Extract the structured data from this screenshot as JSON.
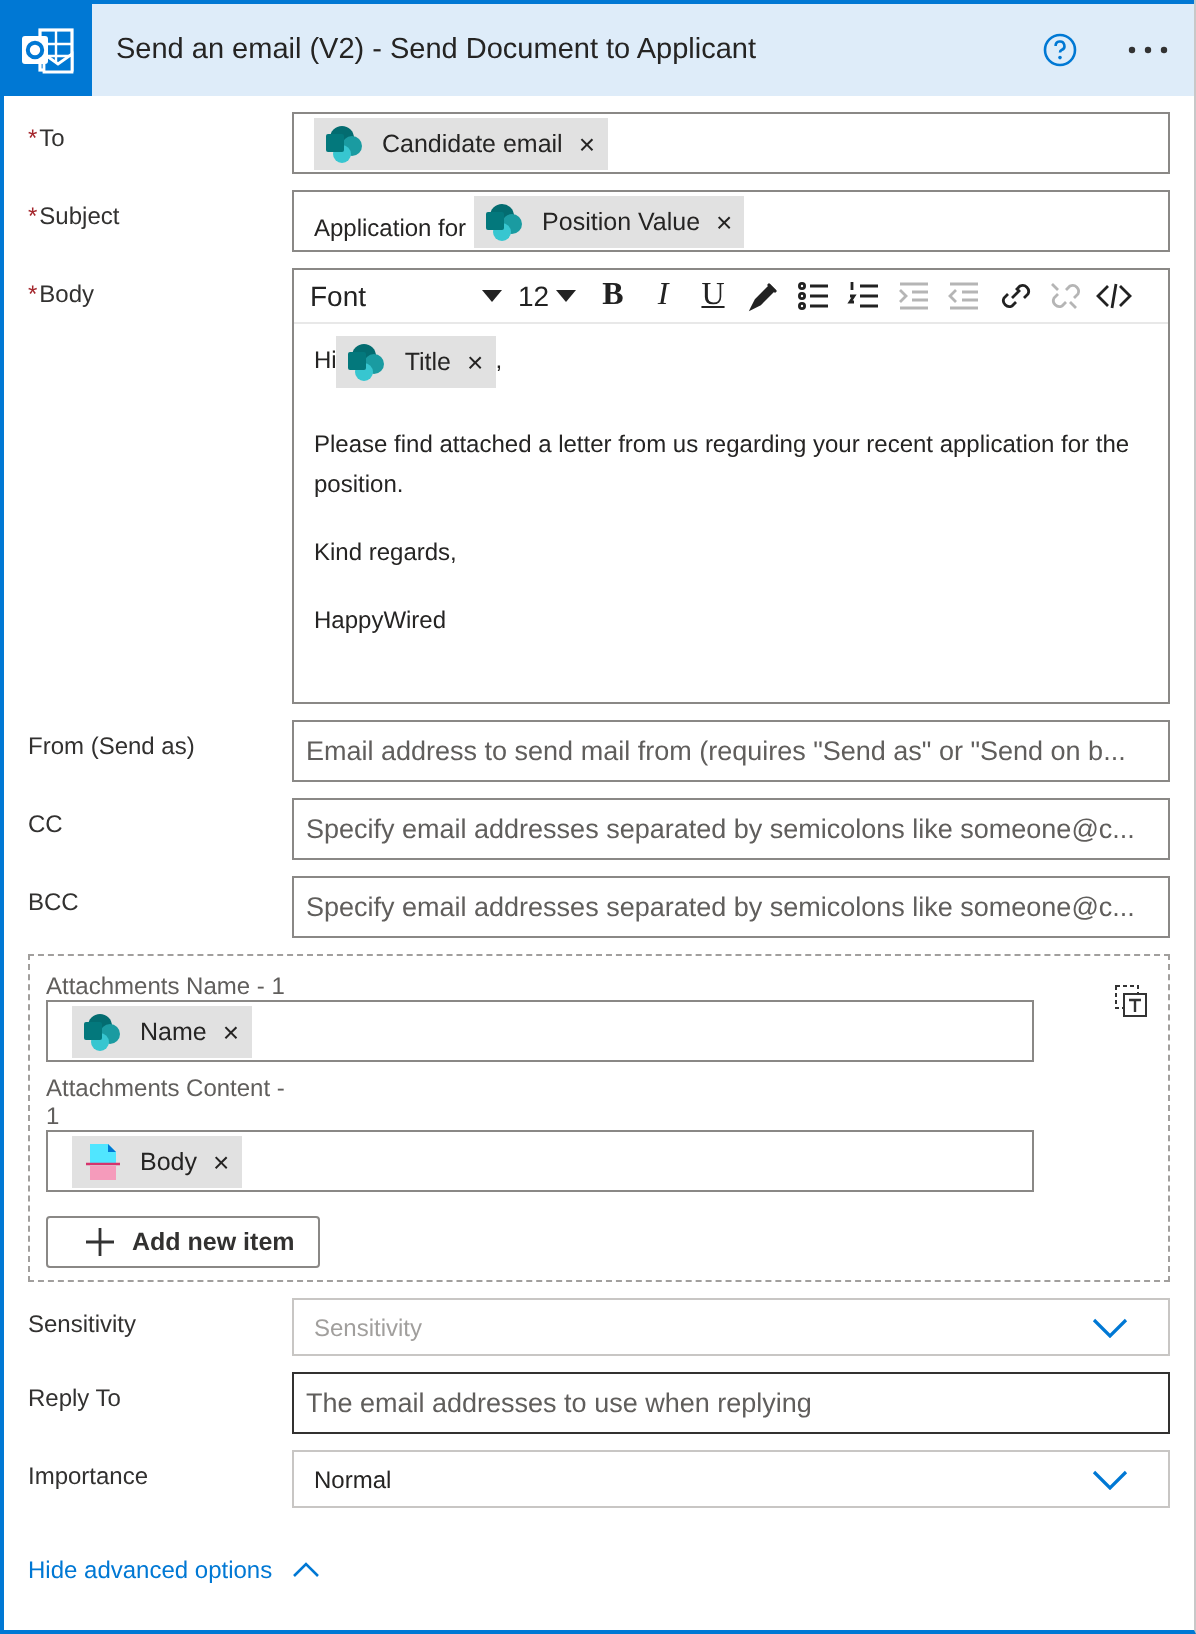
{
  "header": {
    "title": "Send an email (V2) - Send Document to Applicant"
  },
  "fields": [
    {
      "kind": "tokens",
      "label": "To",
      "mark": "*",
      "tokens": [
        {
          "text": "Candidate email",
          "kind": "sharepoint",
          "remove": "×"
        }
      ]
    },
    {
      "kind": "tokens",
      "label": "Subject",
      "mark": "*",
      "prefix": "Application for",
      "tokens": [
        {
          "text": "Position Value",
          "kind": "sharepoint",
          "remove": "×"
        }
      ]
    },
    {
      "kind": "editor",
      "label": "Body",
      "mark": "*",
      "font": "Font",
      "size": "12",
      "buttons": [
        {
          "kind": "bold",
          "label": "B",
          "disabled": false
        },
        {
          "kind": "italic",
          "label": "I",
          "disabled": false
        },
        {
          "kind": "underline",
          "label": "U",
          "disabled": false
        },
        {
          "kind": "color",
          "disabled": false
        },
        {
          "kind": "bullets",
          "disabled": false
        },
        {
          "kind": "numbers",
          "disabled": false
        },
        {
          "kind": "indent",
          "disabled": true
        },
        {
          "kind": "outdent",
          "disabled": true
        },
        {
          "kind": "link",
          "disabled": false
        },
        {
          "kind": "unlink",
          "disabled": true
        },
        {
          "kind": "code",
          "disabled": false
        }
      ],
      "paragraphs": [
        [
          {
            "kind": "text",
            "text": "Hi"
          },
          {
            "kind": "sharepoint",
            "text": "Title",
            "remove": "×"
          },
          {
            "kind": "text",
            "text": ","
          }
        ],
        [
          {
            "kind": "text",
            "text": "Please find attached a letter from us regarding your recent application for the position."
          }
        ],
        [
          {
            "kind": "text",
            "text": "Kind regards,"
          }
        ],
        [
          {
            "kind": "text",
            "text": "HappyWired"
          }
        ]
      ]
    },
    {
      "kind": "text",
      "label": "From (Send as)",
      "placeholder": "Email address to send mail from (requires \"Send as\" or \"Send on b...",
      "focused": false
    },
    {
      "kind": "text",
      "label": "CC",
      "placeholder": "Specify email addresses separated by semicolons like someone@c...",
      "focused": false
    },
    {
      "kind": "text",
      "label": "BCC",
      "placeholder": "Specify email addresses separated by semicolons like someone@c...",
      "focused": false
    },
    {
      "kind": "array",
      "items": [
        {
          "label": "Attachments Name - 1",
          "tokens": [
            {
              "text": "Name",
              "kind": "sharepoint",
              "remove": "×"
            }
          ]
        },
        {
          "label": "Attachments Content - 1",
          "tokens": [
            {
              "text": "Body",
              "kind": "file",
              "remove": "×"
            }
          ]
        }
      ],
      "add_label": "Add new item"
    },
    {
      "kind": "dropdown",
      "label": "Sensitivity",
      "placeholder": "Sensitivity"
    },
    {
      "kind": "text",
      "label": "Reply To",
      "placeholder": "The email addresses to use when replying",
      "focused": true
    },
    {
      "kind": "dropdown",
      "label": "Importance",
      "value": "Normal"
    }
  ],
  "footer": {
    "link": "Hide advanced options"
  }
}
